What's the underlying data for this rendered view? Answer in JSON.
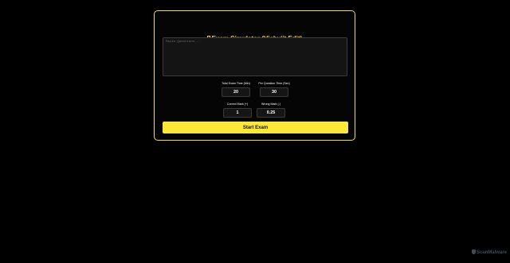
{
  "app": {
    "title": "Exam Simulator (Vishvjit Edit)",
    "title_icon": "book-icon"
  },
  "questions": {
    "placeholder": "Paste Questions...",
    "value": ""
  },
  "settings": {
    "total_time_label": "Total Exam Time (Min)",
    "total_time_value": "20",
    "per_question_label": "Per Question Time (Sec)",
    "per_question_value": "30",
    "correct_mark_label": "Correct Mark (+)",
    "correct_mark_value": "1",
    "wrong_mark_label": "Wrong Mark (-)",
    "wrong_mark_value": "0.25"
  },
  "actions": {
    "start_label": "Start Exam"
  },
  "watermark": {
    "text": "ScanMalware",
    "icon": "shield-icon"
  },
  "colors": {
    "accent": "#f5dd3a",
    "button": "#fde83a",
    "background": "#000000"
  }
}
